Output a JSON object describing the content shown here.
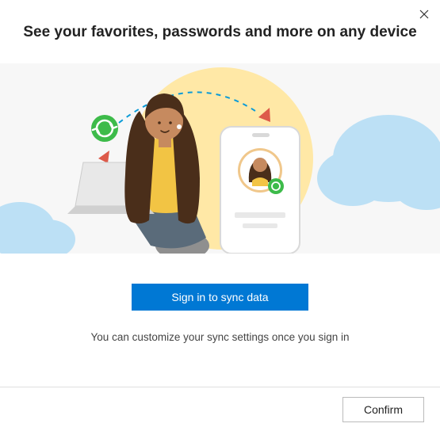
{
  "dialog": {
    "title": "See your favorites, passwords and more on any device",
    "primary_button_label": "Sign in to sync data",
    "hint_text": "You can customize your sync settings once you sign in",
    "confirm_button_label": "Confirm"
  }
}
